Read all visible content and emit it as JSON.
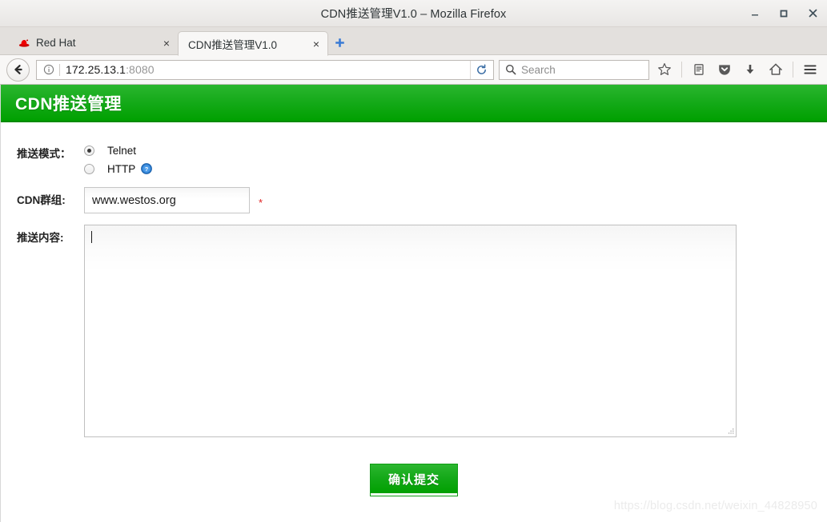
{
  "window": {
    "title": "CDN推送管理V1.0 – Mozilla Firefox",
    "minimize_label": "Minimize",
    "maximize_label": "Maximize",
    "close_label": "Close"
  },
  "tabs": [
    {
      "label": "Red Hat",
      "favicon": "redhat-icon",
      "active": false,
      "close_label": "×"
    },
    {
      "label": "CDN推送管理V1.0",
      "favicon": "page-icon",
      "active": true,
      "close_label": "×"
    }
  ],
  "newtab": {
    "label": "+"
  },
  "toolbar": {
    "back_label": "Back",
    "identity_label": "Site information",
    "url": "172.25.13.1",
    "url_port": ":8080",
    "reload_label": "Reload",
    "search_placeholder": "Search",
    "bookmark_label": "Bookmark this page",
    "library_label": "Library",
    "pocket_label": "Save to Pocket",
    "downloads_label": "Downloads",
    "home_label": "Home",
    "menu_label": "Open menu"
  },
  "page": {
    "header_title": "CDN推送管理",
    "accent_color": "#00a000",
    "form": {
      "mode": {
        "label": "推送模式：",
        "options": [
          {
            "value": "telnet",
            "label": "Telnet",
            "checked": true
          },
          {
            "value": "http",
            "label": "HTTP",
            "checked": false
          }
        ],
        "help_icon": "help-circle-icon"
      },
      "group": {
        "label": "CDN群组:",
        "value": "www.westos.org",
        "placeholder": "",
        "required_marker": "*"
      },
      "content": {
        "label": "推送内容:",
        "value": "",
        "placeholder": ""
      },
      "submit": {
        "label": "确认提交"
      }
    },
    "watermark": "https://blog.csdn.net/weixin_44828950"
  }
}
